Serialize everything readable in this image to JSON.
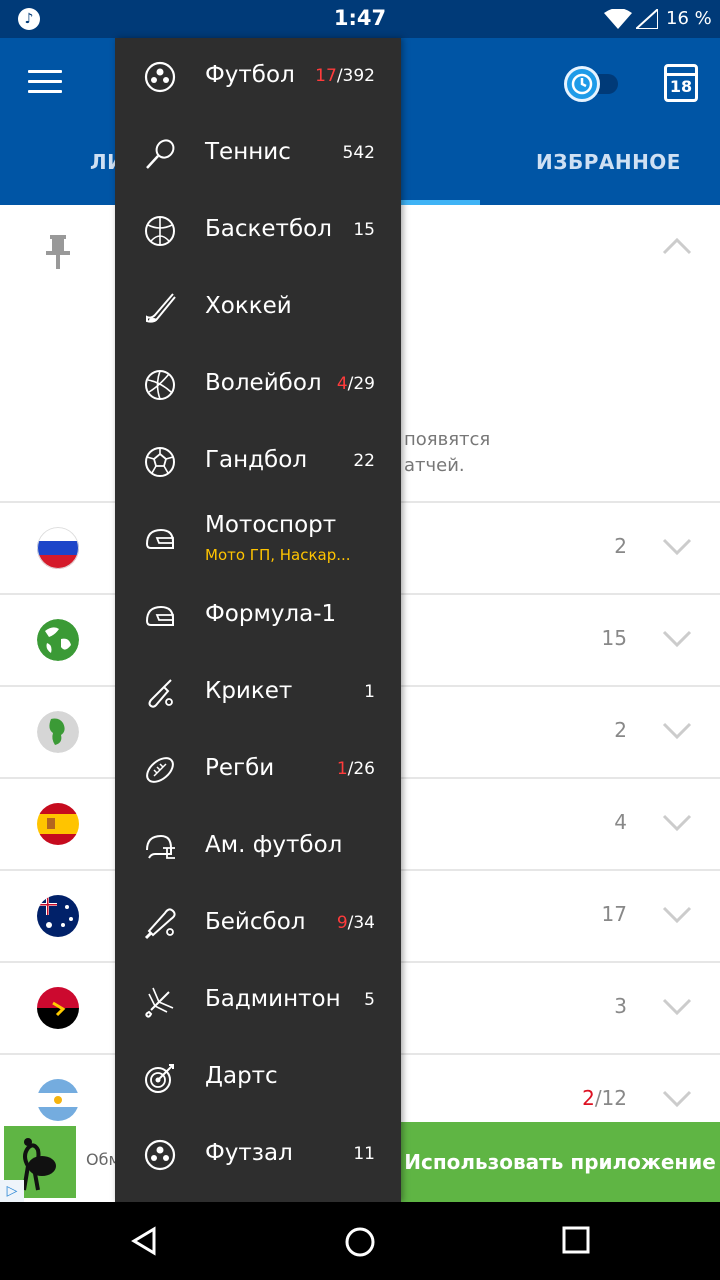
{
  "status_bar": {
    "time": "1:47",
    "battery": "16 %"
  },
  "header": {
    "tabs": [
      {
        "label": "ЛИ"
      },
      {
        "label": "ИЗБРАННОЕ"
      }
    ]
  },
  "content": {
    "info_line1": "появятся",
    "info_line2": "атчей.",
    "rows": [
      {
        "flag": "russia",
        "count": "2"
      },
      {
        "flag": "world",
        "count": "15"
      },
      {
        "flag": "europe",
        "count": "2"
      },
      {
        "flag": "spain",
        "count": "4"
      },
      {
        "flag": "australia",
        "count": "17"
      },
      {
        "flag": "angola",
        "count": "3"
      },
      {
        "flag": "argentina",
        "live": "2",
        "count": "/12"
      }
    ]
  },
  "ad": {
    "text": "Обм",
    "cta": "Использовать приложение"
  },
  "drawer": {
    "sports": [
      {
        "name": "Футбол",
        "icon": "soccer-ball-icon",
        "live": "17",
        "count": "/392"
      },
      {
        "name": "Теннис",
        "icon": "tennis-racket-icon",
        "live": "",
        "count": "542"
      },
      {
        "name": "Баскетбол",
        "icon": "basketball-icon",
        "live": "",
        "count": "15"
      },
      {
        "name": "Хоккей",
        "icon": "hockey-stick-icon",
        "live": "",
        "count": ""
      },
      {
        "name": "Волейбол",
        "icon": "volleyball-icon",
        "live": "4",
        "count": "/29"
      },
      {
        "name": "Гандбол",
        "icon": "handball-icon",
        "live": "",
        "count": "22"
      },
      {
        "name": "Мотоспорт",
        "icon": "helmet-icon",
        "sub": "Мото ГП, Наскар...",
        "live": "",
        "count": ""
      },
      {
        "name": "Формула-1",
        "icon": "helmet-icon",
        "live": "",
        "count": ""
      },
      {
        "name": "Крикет",
        "icon": "cricket-bat-icon",
        "live": "",
        "count": "1"
      },
      {
        "name": "Регби",
        "icon": "rugby-ball-icon",
        "live": "1",
        "count": "/26"
      },
      {
        "name": "Ам. футбол",
        "icon": "football-helmet-icon",
        "live": "",
        "count": ""
      },
      {
        "name": "Бейсбол",
        "icon": "baseball-bat-icon",
        "live": "9",
        "count": "/34"
      },
      {
        "name": "Бадминтон",
        "icon": "shuttlecock-icon",
        "live": "",
        "count": "5"
      },
      {
        "name": "Дартс",
        "icon": "dartboard-icon",
        "live": "",
        "count": ""
      },
      {
        "name": "Футзал",
        "icon": "futsal-ball-icon",
        "live": "",
        "count": "11"
      }
    ]
  },
  "colors": {
    "primary": "#0055a5",
    "status": "#003a78",
    "drawer": "#2e2e2e",
    "live": "#ff3b3b",
    "accent_green": "#5fb544",
    "subtitle": "#ffc400"
  }
}
